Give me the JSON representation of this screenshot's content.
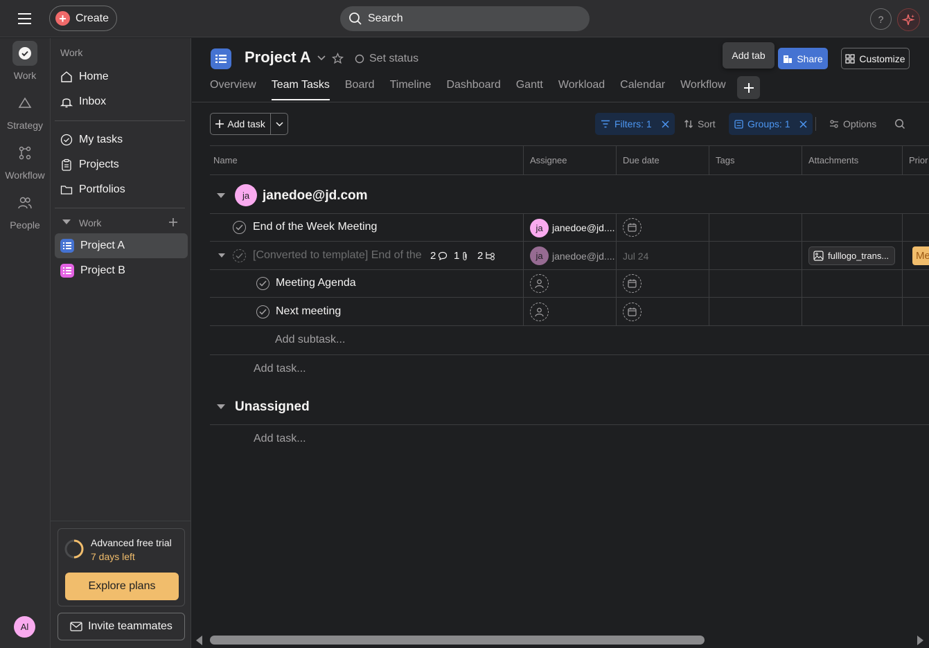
{
  "topbar": {
    "create_label": "Create",
    "search_placeholder": "Search",
    "help_label": "?"
  },
  "rail": {
    "items": [
      {
        "label": "Work",
        "icon": "check-circle-icon"
      },
      {
        "label": "Strategy",
        "icon": "triangle-icon"
      },
      {
        "label": "Workflow",
        "icon": "workflow-icon"
      },
      {
        "label": "People",
        "icon": "people-icon"
      }
    ],
    "avatar_initials": "Al"
  },
  "sidebar": {
    "section_label": "Work",
    "nav": [
      {
        "label": "Home",
        "icon": "home-icon"
      },
      {
        "label": "Inbox",
        "icon": "bell-icon"
      },
      {
        "label": "My tasks",
        "icon": "check-circle-icon"
      },
      {
        "label": "Projects",
        "icon": "clipboard-icon"
      },
      {
        "label": "Portfolios",
        "icon": "folder-icon"
      }
    ],
    "work_group_label": "Work",
    "projects": [
      {
        "label": "Project A",
        "color": "#4573d2",
        "active": true
      },
      {
        "label": "Project B",
        "color": "#e362e3",
        "active": false
      }
    ],
    "trial": {
      "title": "Advanced free trial",
      "days_left": "7 days left",
      "cta": "Explore plans"
    },
    "invite_label": "Invite teammates"
  },
  "project": {
    "title": "Project A",
    "set_status": "Set status",
    "tabs": [
      "Overview",
      "Team Tasks",
      "Board",
      "Timeline",
      "Dashboard",
      "Gantt",
      "Workload",
      "Calendar",
      "Workflow"
    ],
    "active_tab": "Team Tasks",
    "add_tab_tooltip": "Add tab",
    "share_label": "Share",
    "customize_label": "Customize"
  },
  "toolbar": {
    "add_task_label": "Add task",
    "filters_label": "Filters: 1",
    "sort_label": "Sort",
    "groups_label": "Groups: 1",
    "options_label": "Options"
  },
  "table": {
    "columns": [
      "Name",
      "Assignee",
      "Due date",
      "Tags",
      "Attachments",
      "Prior"
    ],
    "groups": [
      {
        "title": "janedoe@jd.com",
        "avatar": "ja",
        "rows": [
          {
            "name": "End of the Week Meeting",
            "assignee": "janedoe@jd....",
            "avatar": "ja",
            "due": ""
          },
          {
            "name": "[Converted to template] End of the",
            "comments": "2",
            "attachments_count": "1",
            "subtasks": "2",
            "assignee": "janedoe@jd....",
            "avatar": "ja",
            "due": "Jul 24",
            "attachment": "fulllogo_trans...",
            "priority": "Me"
          },
          {
            "name": "Meeting Agenda",
            "assignee": "",
            "due": ""
          },
          {
            "name": "Next meeting",
            "assignee": "",
            "due": ""
          }
        ],
        "add_subtask": "Add subtask...",
        "add_task": "Add task..."
      },
      {
        "title": "Unassigned",
        "rows": [],
        "add_task": "Add task..."
      }
    ]
  },
  "colors": {
    "accent_blue": "#4573d2",
    "create_red": "#f06a6a",
    "trial_yellow": "#f1bd6c",
    "avatar_pink": "#f9aaef"
  }
}
